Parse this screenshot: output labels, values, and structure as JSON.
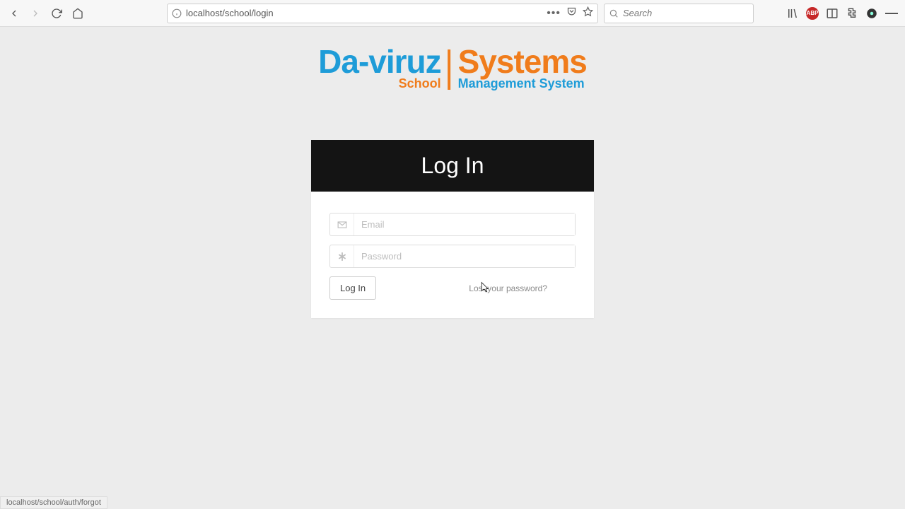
{
  "browser": {
    "url": "localhost/school/login",
    "search_placeholder": "Search",
    "abp_label": "ABP"
  },
  "logo": {
    "left_brand": "Da-viruz",
    "left_tag": "School",
    "right_brand": "Systems",
    "right_tag": "Management System"
  },
  "login": {
    "heading": "Log In",
    "email_placeholder": "Email",
    "password_placeholder": "Password",
    "submit_label": "Log In",
    "forgot_label": "Lost your password?"
  },
  "status": {
    "hover_url": "localhost/school/auth/forgot"
  }
}
